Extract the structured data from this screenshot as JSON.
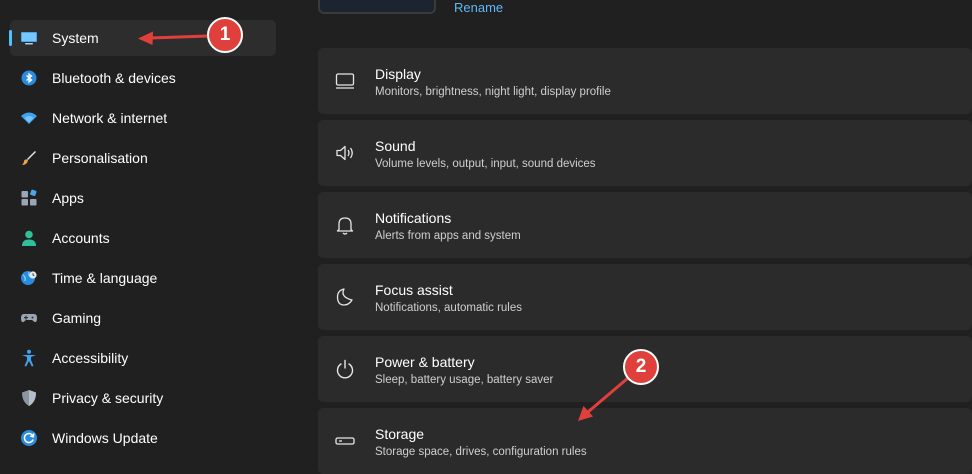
{
  "sidebar": {
    "items": [
      {
        "label": "System",
        "icon": "monitor-icon"
      },
      {
        "label": "Bluetooth & devices",
        "icon": "bluetooth-icon"
      },
      {
        "label": "Network & internet",
        "icon": "wifi-icon"
      },
      {
        "label": "Personalisation",
        "icon": "brush-icon"
      },
      {
        "label": "Apps",
        "icon": "apps-icon"
      },
      {
        "label": "Accounts",
        "icon": "person-icon"
      },
      {
        "label": "Time & language",
        "icon": "globe-clock-icon"
      },
      {
        "label": "Gaming",
        "icon": "gamepad-icon"
      },
      {
        "label": "Accessibility",
        "icon": "accessibility-icon"
      },
      {
        "label": "Privacy & security",
        "icon": "shield-icon"
      },
      {
        "label": "Windows Update",
        "icon": "update-icon"
      }
    ]
  },
  "header": {
    "rename_label": "Rename"
  },
  "cards": [
    {
      "title": "Display",
      "desc": "Monitors, brightness, night light, display profile",
      "icon": "display-icon"
    },
    {
      "title": "Sound",
      "desc": "Volume levels, output, input, sound devices",
      "icon": "speaker-icon"
    },
    {
      "title": "Notifications",
      "desc": "Alerts from apps and system",
      "icon": "bell-icon"
    },
    {
      "title": "Focus assist",
      "desc": "Notifications, automatic rules",
      "icon": "moon-icon"
    },
    {
      "title": "Power & battery",
      "desc": "Sleep, battery usage, battery saver",
      "icon": "power-icon"
    },
    {
      "title": "Storage",
      "desc": "Storage space, drives, configuration rules",
      "icon": "drive-icon"
    }
  ],
  "annotations": {
    "badge1": "1",
    "badge2": "2"
  },
  "colors": {
    "accent": "#4cc2ff",
    "annotation_red": "#e0403c",
    "link": "#5eb8f5"
  }
}
